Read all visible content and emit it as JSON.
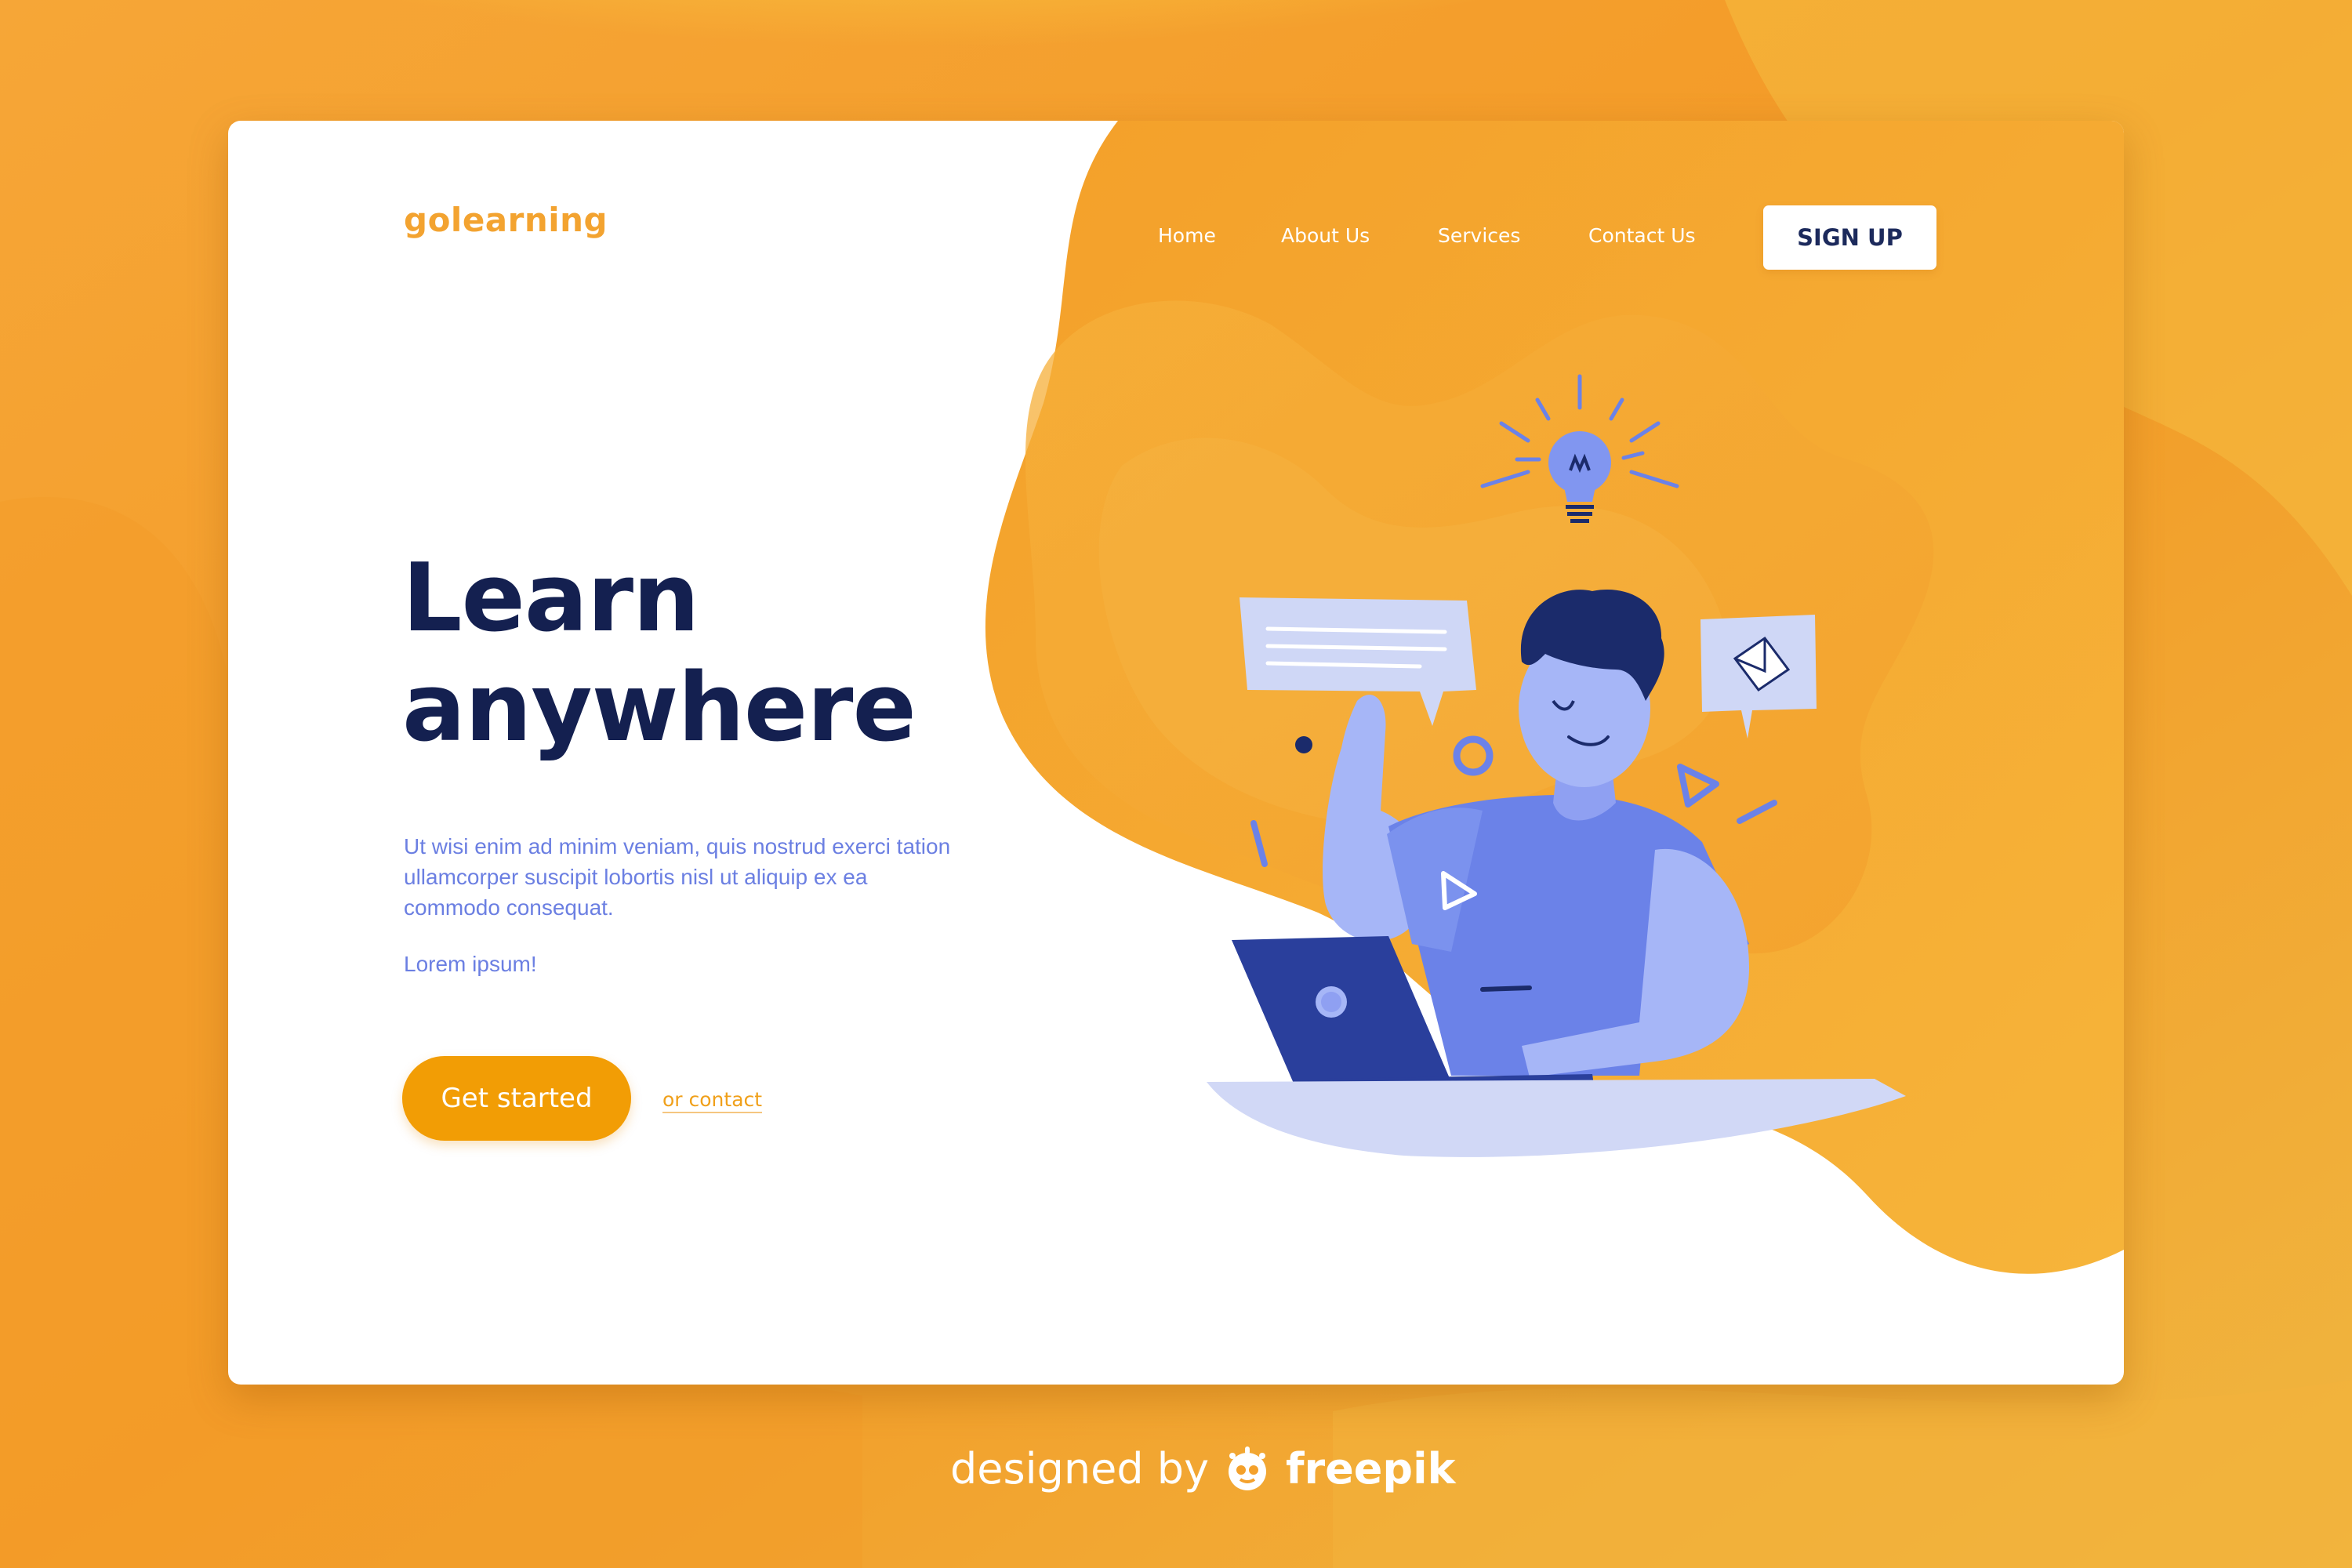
{
  "brand": {
    "logo": "golearning"
  },
  "nav": {
    "items": [
      {
        "label": "Home"
      },
      {
        "label": "About Us"
      },
      {
        "label": "Services"
      },
      {
        "label": "Contact Us"
      }
    ],
    "signup_label": "SIGN UP"
  },
  "hero": {
    "title_line1": "Learn",
    "title_line2": "anywhere",
    "body": "Ut wisi enim ad minim veniam, quis nostrud exerci tation ullamcorper suscipit lobortis nisl ut aliquip ex ea commodo consequat.",
    "tagline": "Lorem ipsum!",
    "cta_label": "Get started",
    "secondary_link": "or contact"
  },
  "footer": {
    "designed_by": "designed by",
    "brand": "freepik",
    "icon": "freepik-logo-icon"
  },
  "icons": [
    "lightbulb-icon",
    "envelope-icon",
    "play-icon",
    "speech-bubble-icon",
    "laptop-icon"
  ],
  "colors": {
    "accent_orange": "#f29d05",
    "background_orange": "#f4a12b",
    "navy_text": "#142050",
    "body_blue": "#6b7fe2",
    "illustration_blue": "#6b82e8"
  }
}
